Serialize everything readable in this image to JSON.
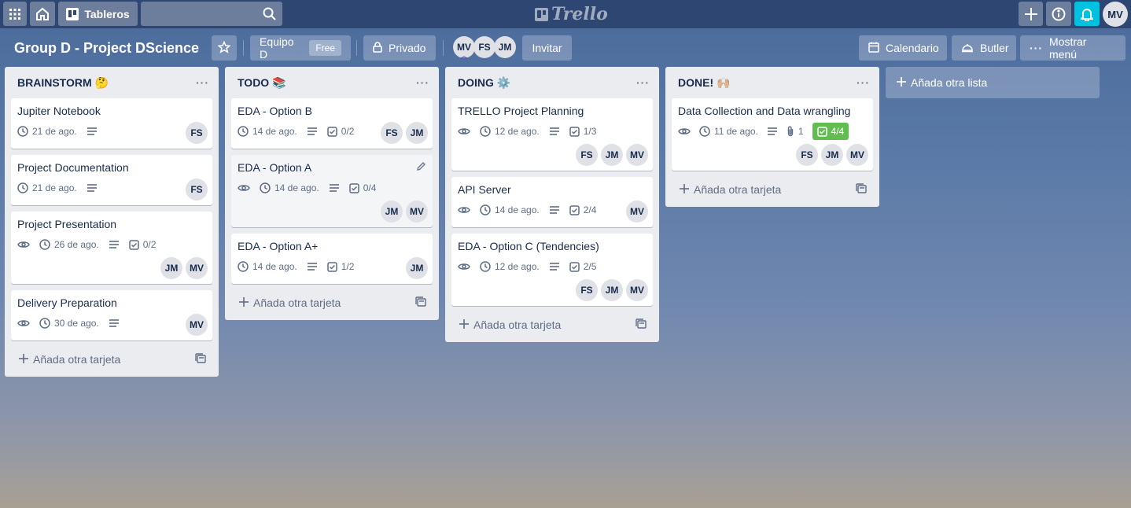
{
  "topbar": {
    "boards_label": "Tableros",
    "logo_text": "Trello",
    "user_initials": "MV"
  },
  "board": {
    "title": "Group D - Project DScience",
    "team_label": "Equipo D",
    "team_plan": "Free",
    "visibility_label": "Privado",
    "members": [
      "MV",
      "FS",
      "JM"
    ],
    "invite_label": "Invitar",
    "calendar_label": "Calendario",
    "butler_label": "Butler",
    "show_menu_label": "Mostrar menú"
  },
  "add_card_label": "Añada otra tarjeta",
  "add_list_label": "Añada otra lista",
  "lists": [
    {
      "title": "BRAINSTORM 🤔",
      "cards": [
        {
          "title": "Jupiter Notebook",
          "watch": false,
          "due": "21 de ago.",
          "checklist": "",
          "members": [
            "FS"
          ]
        },
        {
          "title": "Project Documentation",
          "watch": false,
          "due": "21 de ago.",
          "checklist": "",
          "members": [
            "FS"
          ]
        },
        {
          "title": "Project Presentation",
          "watch": true,
          "due": "26 de ago.",
          "checklist": "0/2",
          "members": [
            "JM",
            "MV"
          ]
        },
        {
          "title": "Delivery Preparation",
          "watch": true,
          "due": "30 de ago.",
          "checklist": "",
          "members": [
            "MV"
          ]
        }
      ]
    },
    {
      "title": "TODO 📚",
      "cards": [
        {
          "title": "EDA - Option B",
          "watch": false,
          "due": "14 de ago.",
          "checklist": "0/2",
          "members": [
            "FS",
            "JM"
          ]
        },
        {
          "title": "EDA - Option A",
          "watch": true,
          "due": "14 de ago.",
          "checklist": "0/4",
          "members": [
            "JM",
            "MV"
          ]
        },
        {
          "title": "EDA - Option A+",
          "watch": false,
          "due": "14 de ago.",
          "checklist": "1/2",
          "members": [
            "JM"
          ]
        }
      ]
    },
    {
      "title": "DOING ⚙️",
      "cards": [
        {
          "title": "TRELLO Project Planning",
          "watch": true,
          "due": "12 de ago.",
          "checklist": "1/3",
          "members": [
            "FS",
            "JM",
            "MV"
          ]
        },
        {
          "title": "API Server",
          "watch": true,
          "due": "14 de ago.",
          "checklist": "2/4",
          "members": [
            "MV"
          ]
        },
        {
          "title": "EDA - Option C (Tendencies)",
          "watch": true,
          "due": "12 de ago.",
          "checklist": "2/5",
          "members": [
            "FS",
            "JM",
            "MV"
          ]
        }
      ]
    },
    {
      "title": "DONE! 🙌🏼",
      "cards": [
        {
          "title": "Data Collection and Data wrangling",
          "watch": true,
          "due": "11 de ago.",
          "attachments": "1",
          "checklist": "4/4",
          "checklist_complete": true,
          "members": [
            "FS",
            "JM",
            "MV"
          ]
        }
      ]
    }
  ]
}
